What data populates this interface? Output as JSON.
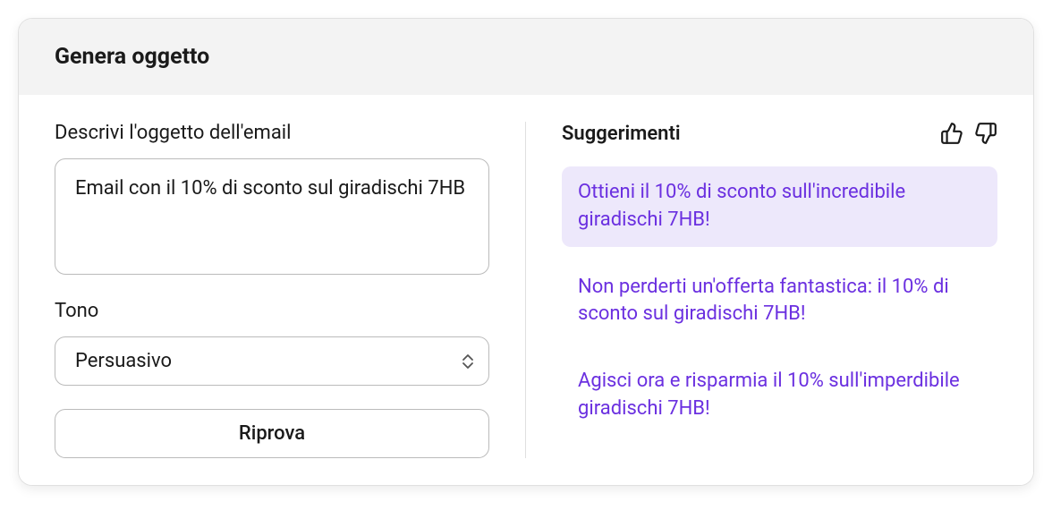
{
  "header": {
    "title": "Genera oggetto"
  },
  "form": {
    "describe_label": "Descrivi l'oggetto dell'email",
    "describe_value": "Email con il 10% di sconto sul giradischi 7HB",
    "tone_label": "Tono",
    "tone_value": "Persuasivo",
    "retry_label": "Riprova"
  },
  "suggestions": {
    "title": "Suggerimenti",
    "items": [
      "Ottieni il 10% di sconto sull'incredibile giradischi 7HB!",
      "Non perderti un'offerta fantastica: il 10% di sconto sul giradischi 7HB!",
      "Agisci ora e risparmia il 10% sull'imperdibile giradischi 7HB!"
    ]
  }
}
